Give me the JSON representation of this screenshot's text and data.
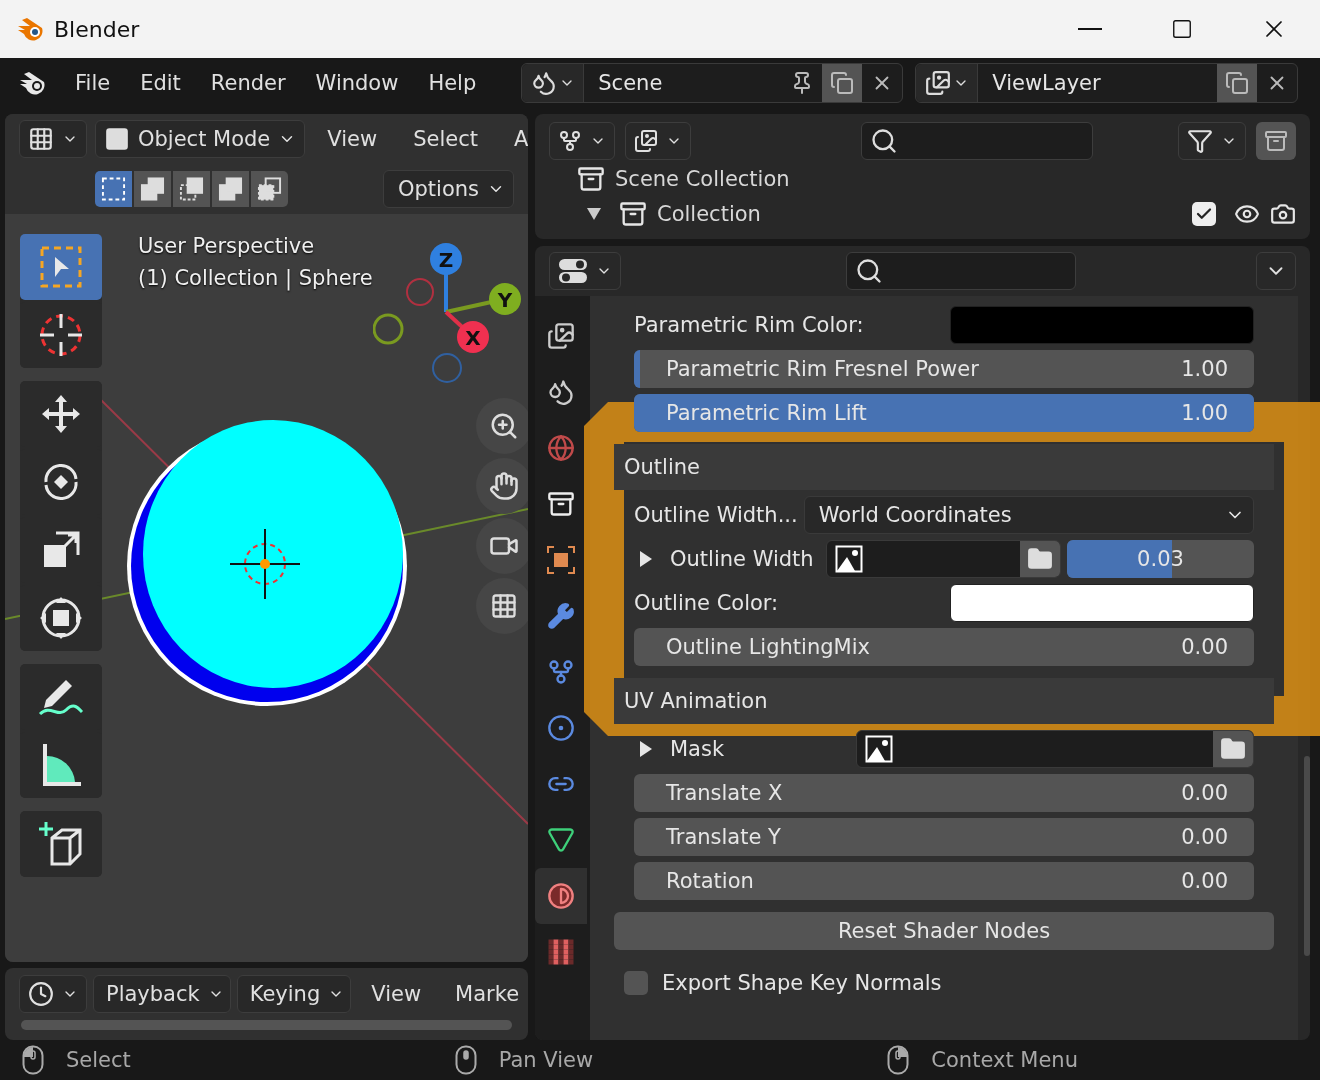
{
  "window": {
    "title": "Blender"
  },
  "menu": [
    "File",
    "Edit",
    "Render",
    "Window",
    "Help"
  ],
  "scene": {
    "label": "Scene"
  },
  "view_layer": {
    "label": "ViewLayer"
  },
  "viewport": {
    "mode": "Object Mode",
    "menus": [
      "View",
      "Select",
      "A"
    ],
    "options": "Options",
    "select_modes": [
      {
        "selected": true
      },
      {
        "selected": false
      },
      {
        "selected": false
      },
      {
        "selected": false
      },
      {
        "selected": false
      }
    ],
    "overlay": [
      "User Perspective",
      "(1) Collection | Sphere"
    ],
    "gizmo_axes": [
      "Z",
      "Y",
      "X"
    ],
    "tool_groups": [
      {
        "tools": [
          {
            "kind": "select",
            "selected": true
          },
          {
            "kind": "cursor",
            "selected": false
          }
        ]
      },
      {
        "tools": [
          {
            "kind": "move",
            "selected": false
          },
          {
            "kind": "rotate",
            "selected": false
          },
          {
            "kind": "scale",
            "selected": false
          },
          {
            "kind": "transform",
            "selected": false
          }
        ]
      },
      {
        "tools": [
          {
            "kind": "annotate",
            "selected": false
          },
          {
            "kind": "measure",
            "selected": false
          }
        ]
      },
      {
        "tools": [
          {
            "kind": "add",
            "selected": false
          }
        ]
      }
    ]
  },
  "timeline": {
    "menus": [
      {
        "label": "Playback",
        "kind": "dropdown"
      },
      {
        "label": "Keying",
        "kind": "dropdown"
      },
      {
        "label": "View",
        "kind": "plain"
      },
      {
        "label": "Marke",
        "kind": "plain"
      }
    ]
  },
  "outliner": {
    "items": [
      {
        "label": "Scene Collection",
        "children": [
          {
            "label": "Collection",
            "expanded": true,
            "checked": true
          }
        ]
      }
    ]
  },
  "properties": {
    "highlight": true,
    "tabs": [
      {
        "kind": "output",
        "selected": false
      },
      {
        "kind": "scene",
        "selected": false
      },
      {
        "kind": "world",
        "selected": false
      },
      {
        "kind": "collection",
        "selected": false
      },
      {
        "kind": "object",
        "selected": false
      },
      {
        "kind": "modifier",
        "selected": false
      },
      {
        "kind": "particles",
        "selected": false
      },
      {
        "kind": "physics",
        "selected": false
      },
      {
        "kind": "constraints",
        "selected": false
      },
      {
        "kind": "data",
        "selected": false
      },
      {
        "kind": "material",
        "selected": true
      },
      {
        "kind": "texture",
        "selected": false
      }
    ],
    "rows": [
      {
        "kind": "color",
        "label": "Parametric Rim Color:",
        "color": "#000000"
      },
      {
        "kind": "slider",
        "label": "Parametric Rim Fresnel Power",
        "value": "1.00",
        "level": 0.01
      },
      {
        "kind": "slider",
        "label": "Parametric Rim Lift",
        "value": "1.00",
        "level": 1
      },
      {
        "kind": "section",
        "label": "Outline"
      },
      {
        "kind": "dropdown",
        "label": "Outline Width...",
        "value": "World Coordinates"
      },
      {
        "kind": "texture",
        "label": "Outline Width",
        "expanded": false,
        "value": "0.03",
        "level": 0.56
      },
      {
        "kind": "color",
        "label": "Outline Color:",
        "color": "#ffffff"
      },
      {
        "kind": "slider",
        "label": "Outline LightingMix",
        "value": "0.00"
      },
      {
        "kind": "section",
        "label": "UV Animation"
      },
      {
        "kind": "texture",
        "label": "Mask",
        "expanded": false
      },
      {
        "kind": "slider",
        "label": "Translate X",
        "value": "0.00"
      },
      {
        "kind": "slider",
        "label": "Translate Y",
        "value": "0.00"
      },
      {
        "kind": "slider",
        "label": "Rotation",
        "value": "0.00"
      },
      {
        "kind": "button",
        "label": "Reset Shader Nodes"
      },
      {
        "kind": "checkbox",
        "label": "Export Shape Key Normals",
        "checked": false
      }
    ]
  },
  "status_bar": [
    {
      "kind": "left",
      "label": "Select"
    },
    {
      "kind": "middle",
      "label": "Pan View"
    },
    {
      "kind": "right",
      "label": "Context Menu"
    }
  ]
}
